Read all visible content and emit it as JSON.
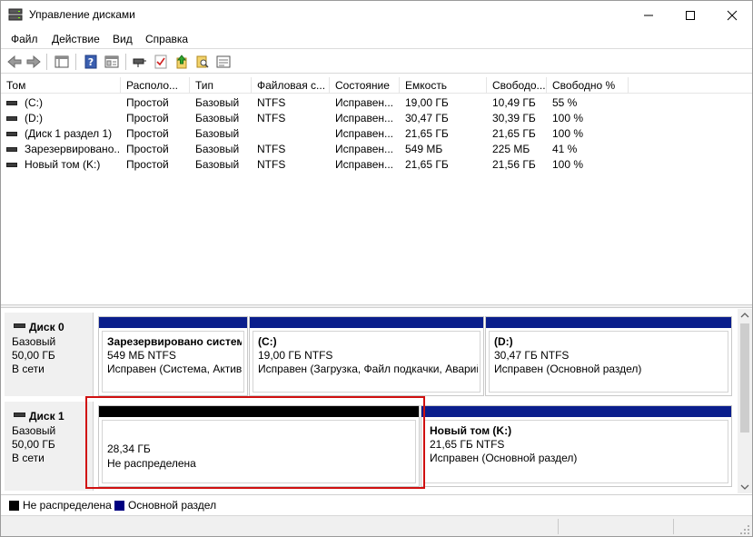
{
  "window": {
    "title": "Управление дисками"
  },
  "menu": [
    "Файл",
    "Действие",
    "Вид",
    "Справка"
  ],
  "toolbar": {
    "icons": [
      "back-icon",
      "forward-icon",
      "console-tree-icon",
      "help-icon",
      "properties-icon",
      "connect-icon",
      "check-icon",
      "up-icon",
      "search-icon",
      "list-icon"
    ]
  },
  "columns": [
    "Том",
    "Располо...",
    "Тип",
    "Файловая с...",
    "Состояние",
    "Емкость",
    "Свободо...",
    "Свободно %"
  ],
  "volumes": [
    {
      "name": "(C:)",
      "layout": "Простой",
      "type": "Базовый",
      "fs": "NTFS",
      "status": "Исправен...",
      "capacity": "19,00 ГБ",
      "free": "10,49 ГБ",
      "free_pct": "55 %"
    },
    {
      "name": "(D:)",
      "layout": "Простой",
      "type": "Базовый",
      "fs": "NTFS",
      "status": "Исправен...",
      "capacity": "30,47 ГБ",
      "free": "30,39 ГБ",
      "free_pct": "100 %"
    },
    {
      "name": "(Диск 1 раздел 1)",
      "layout": "Простой",
      "type": "Базовый",
      "fs": "",
      "status": "Исправен...",
      "capacity": "21,65 ГБ",
      "free": "21,65 ГБ",
      "free_pct": "100 %"
    },
    {
      "name": "Зарезервировано...",
      "layout": "Простой",
      "type": "Базовый",
      "fs": "NTFS",
      "status": "Исправен...",
      "capacity": "549 МБ",
      "free": "225 МБ",
      "free_pct": "41 %"
    },
    {
      "name": "Новый том (K:)",
      "layout": "Простой",
      "type": "Базовый",
      "fs": "NTFS",
      "status": "Исправен...",
      "capacity": "21,65 ГБ",
      "free": "21,56 ГБ",
      "free_pct": "100 %"
    }
  ],
  "disks": [
    {
      "name": "Диск 0",
      "type": "Базовый",
      "size": "50,00 ГБ",
      "state": "В сети",
      "partitions": [
        {
          "title": "Зарезервировано системо",
          "size": "549 МБ NTFS",
          "status": "Исправен (Система, Активе"
        },
        {
          "title": "(C:)",
          "size": "19,00 ГБ NTFS",
          "status": "Исправен (Загрузка, Файл подкачки, Аварий"
        },
        {
          "title": "(D:)",
          "size": "30,47 ГБ NTFS",
          "status": "Исправен (Основной раздел)"
        }
      ]
    },
    {
      "name": "Диск 1",
      "type": "Базовый",
      "size": "50,00 ГБ",
      "state": "В сети",
      "partitions": [
        {
          "title": "",
          "size": "28,34 ГБ",
          "status": "Не распределена"
        },
        {
          "title": "Новый том  (K:)",
          "size": "21,65 ГБ NTFS",
          "status": "Исправен (Основной раздел)"
        }
      ]
    }
  ],
  "legend": [
    {
      "label": "Не распределена",
      "color": "#000000"
    },
    {
      "label": "Основной раздел",
      "color": "#000080"
    }
  ],
  "colors": {
    "primary_bar": "#0a1e8c",
    "unallocated_bar": "#000000",
    "highlight": "#d01010"
  }
}
